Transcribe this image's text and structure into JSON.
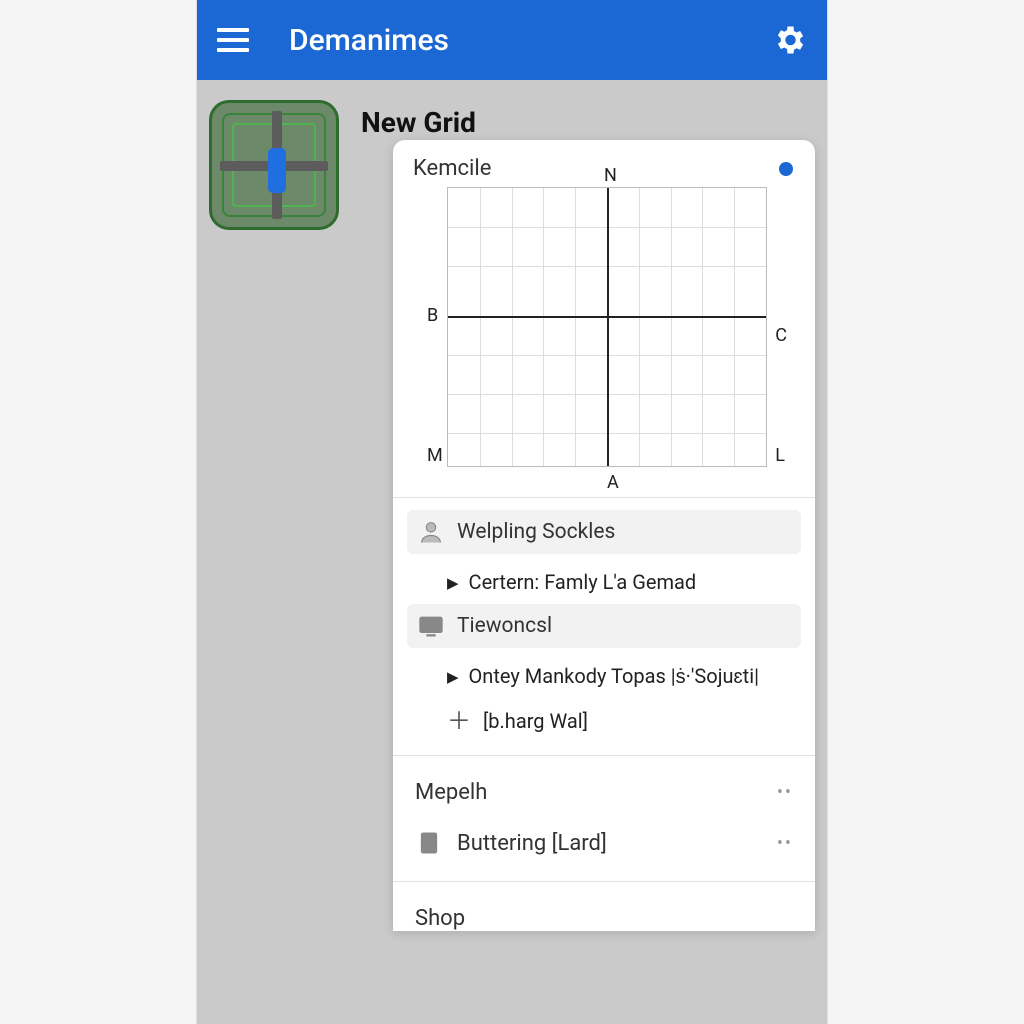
{
  "header": {
    "title": "Demanimes"
  },
  "card": {
    "title": "New Grid"
  },
  "panel": {
    "title": "Kemcile",
    "axis_labels": {
      "top": "N",
      "left": "B",
      "right": "C",
      "bottom_left": "M",
      "bottom": "A",
      "bottom_right": "L"
    }
  },
  "sections": [
    {
      "header": "Welpling Sockles",
      "items": [
        {
          "type": "tri",
          "text": "Certern: Famly L'a Gemad"
        }
      ]
    },
    {
      "header": "Tiewoncsl",
      "items": [
        {
          "type": "tri",
          "text": "Ontey Mankody Topas |ṡ·'Sojuɛti|"
        },
        {
          "type": "plus",
          "text": "[b.harg Wal]"
        }
      ]
    }
  ],
  "footer_rows": [
    {
      "label": "Mepelh",
      "icon": "none"
    },
    {
      "label": "Buttering [Lard]",
      "icon": "clipboard"
    },
    {
      "label": "Shop",
      "icon": "none"
    }
  ]
}
